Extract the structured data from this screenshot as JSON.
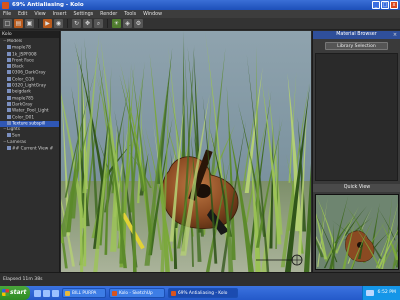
{
  "window": {
    "title": "69% Antialiasing - Kolo",
    "minimize": "_",
    "maximize": "□",
    "close": "x"
  },
  "menu": [
    "File",
    "Edit",
    "View",
    "Insert",
    "Settings",
    "Render",
    "Tools",
    "Window"
  ],
  "toolbar_icons": [
    "new-icon",
    "open-icon",
    "save-icon",
    "render-icon",
    "camera-icon",
    "orbit-icon",
    "pan-icon",
    "zoom-icon",
    "light-icon",
    "material-icon",
    "settings-icon"
  ],
  "scene_panel": {
    "header": "Kolo",
    "items": [
      {
        "label": "Models",
        "level": 0,
        "toggle": "−"
      },
      {
        "label": "maple78",
        "level": 1
      },
      {
        "label": "1k_JSPF008",
        "level": 1
      },
      {
        "label": "Front Face",
        "level": 1
      },
      {
        "label": "Black",
        "level": 1
      },
      {
        "label": "0306_DarkGray",
        "level": 1
      },
      {
        "label": "Color_G16",
        "level": 1
      },
      {
        "label": "0320_LightGray",
        "level": 1
      },
      {
        "label": "beigdark",
        "level": 1
      },
      {
        "label": "maple785",
        "level": 1
      },
      {
        "label": "DarkGray",
        "level": 1
      },
      {
        "label": "Water_Pool_Light",
        "level": 1
      },
      {
        "label": "Color_D01",
        "level": 1
      },
      {
        "label": "Texture subspill",
        "level": 1,
        "selected": true
      },
      {
        "label": "Lights",
        "level": 0,
        "toggle": "−"
      },
      {
        "label": "Sun",
        "level": 1
      },
      {
        "label": "Cameras",
        "level": 0,
        "toggle": "−"
      },
      {
        "label": "## Current View #",
        "level": 1
      }
    ]
  },
  "material_browser": {
    "header": "Material Browser",
    "library_button": "Library Selection",
    "quick_view": "Quick View"
  },
  "status": {
    "elapsed": "Elapsed 11m 38s"
  },
  "taskbar": {
    "start": "start",
    "tasks": [
      {
        "label": "BILL PURPA",
        "active": false,
        "color": "#e8b93a"
      },
      {
        "label": "Kolo - SketchUp",
        "active": false,
        "color": "#d9541e"
      },
      {
        "label": "69% Antialiasing - Kolo",
        "active": true,
        "color": "#d9541e"
      }
    ],
    "clock": "6:52 PM"
  }
}
